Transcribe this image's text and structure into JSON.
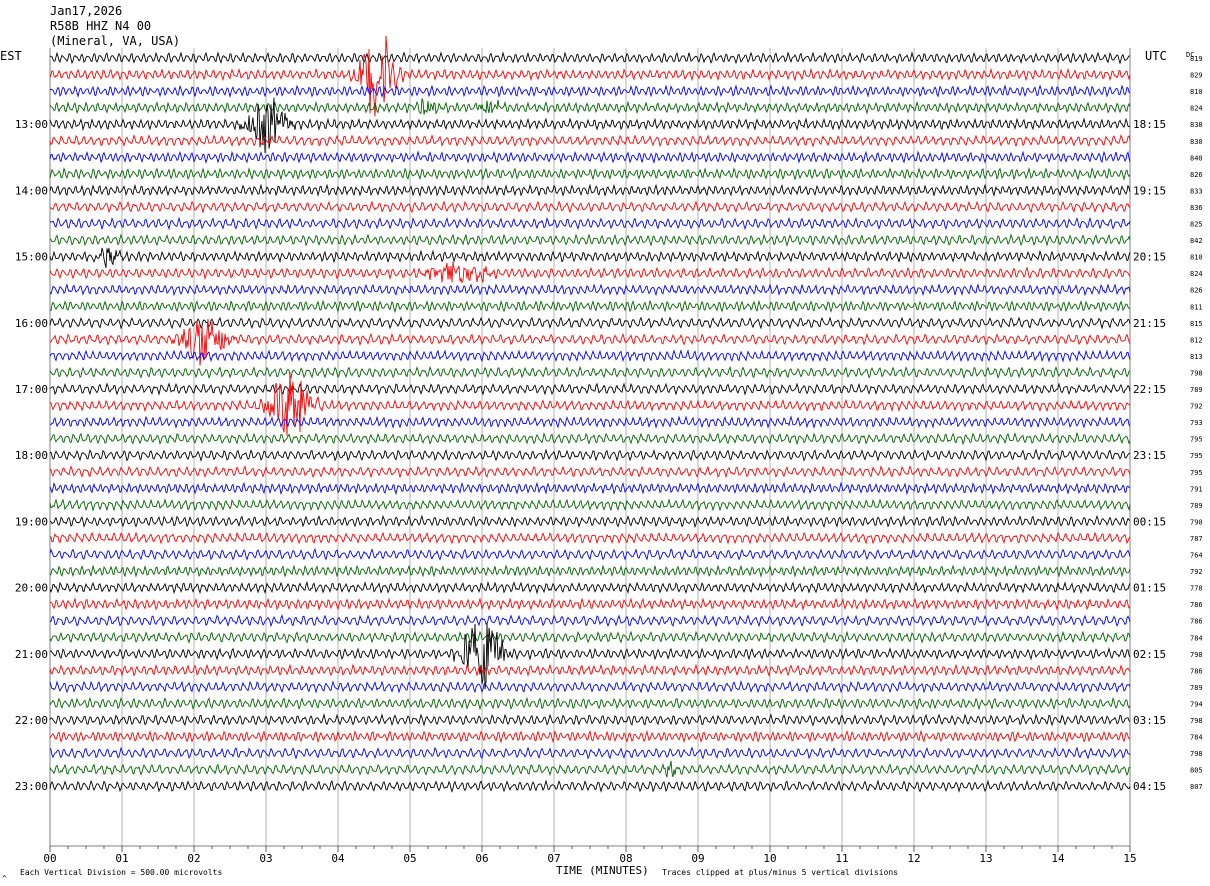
{
  "header": {
    "date": "Jan17,2026",
    "station": "R58B HHZ N4 00",
    "location": "(Mineral, VA, USA)"
  },
  "left_axis_label": "EST",
  "right_axis_label": "UTC",
  "dc_label": "DC",
  "xaxis_title": "TIME (MINUTES)",
  "footer": {
    "scale": "Each Vertical Division =  500.00 microvolts",
    "clip": "Traces clipped at plus/minus 5 vertical divisions",
    "corner_mark": "^"
  },
  "colors": {
    "trace_cycle": [
      "#000000",
      "#ff0000",
      "#0000ff",
      "#006400"
    ],
    "grid": "#808080",
    "text": "#000000",
    "background": "#ffffff"
  },
  "chart_data": {
    "type": "line",
    "title": "",
    "xlabel": "TIME (MINUTES)",
    "ylabel": "",
    "xlim": [
      0,
      15
    ],
    "x_ticks": [
      "00",
      "01",
      "02",
      "03",
      "04",
      "05",
      "06",
      "07",
      "08",
      "09",
      "10",
      "11",
      "12",
      "13",
      "14",
      "15"
    ],
    "grid": true,
    "row_minutes": 15,
    "left_hour_labels": [
      {
        "row": 4,
        "label": "13:00"
      },
      {
        "row": 8,
        "label": "14:00"
      },
      {
        "row": 12,
        "label": "15:00"
      },
      {
        "row": 16,
        "label": "16:00"
      },
      {
        "row": 20,
        "label": "17:00"
      },
      {
        "row": 24,
        "label": "18:00"
      },
      {
        "row": 28,
        "label": "19:00"
      },
      {
        "row": 32,
        "label": "20:00"
      },
      {
        "row": 36,
        "label": "21:00"
      },
      {
        "row": 40,
        "label": "22:00"
      },
      {
        "row": 44,
        "label": "23:00"
      }
    ],
    "right_hour_labels": [
      {
        "row": 4,
        "label": "18:15"
      },
      {
        "row": 8,
        "label": "19:15"
      },
      {
        "row": 12,
        "label": "20:15"
      },
      {
        "row": 16,
        "label": "21:15"
      },
      {
        "row": 20,
        "label": "22:15"
      },
      {
        "row": 24,
        "label": "23:15"
      },
      {
        "row": 28,
        "label": "00:15"
      },
      {
        "row": 32,
        "label": "01:15"
      },
      {
        "row": 36,
        "label": "02:15"
      },
      {
        "row": 40,
        "label": "03:15"
      },
      {
        "row": 44,
        "label": "04:15"
      }
    ],
    "dc_values": [
      "819",
      "829",
      "810",
      "824",
      "838",
      "830",
      "840",
      "826",
      "833",
      "836",
      "825",
      "842",
      "810",
      "824",
      "826",
      "811",
      "815",
      "812",
      "813",
      "798",
      "789",
      "792",
      "793",
      "795",
      "795",
      "795",
      "791",
      "789",
      "790",
      "787",
      "764",
      "792",
      "778",
      "786",
      "786",
      "784",
      "798",
      "786",
      "789",
      "794",
      "798",
      "784",
      "798",
      "805",
      "807"
    ],
    "events": [
      {
        "row": 1,
        "minute": 4.55,
        "amplitude_divisions": 5,
        "duration_min": 0.5,
        "color": "#ff0000"
      },
      {
        "row": 3,
        "minute": 5.2,
        "amplitude_divisions": 0.9,
        "duration_min": 0.4,
        "color": "#006400"
      },
      {
        "row": 3,
        "minute": 6.1,
        "amplitude_divisions": 1.0,
        "duration_min": 0.3,
        "color": "#006400"
      },
      {
        "row": 4,
        "minute": 3.0,
        "amplitude_divisions": 3,
        "duration_min": 0.6,
        "color": "#000000"
      },
      {
        "row": 12,
        "minute": 0.8,
        "amplitude_divisions": 1.0,
        "duration_min": 0.4,
        "color": "#000000"
      },
      {
        "row": 13,
        "minute": 5.7,
        "amplitude_divisions": 1.2,
        "duration_min": 0.9,
        "color": "#ff0000"
      },
      {
        "row": 17,
        "minute": 2.15,
        "amplitude_divisions": 3,
        "duration_min": 0.6,
        "color": "#ff0000"
      },
      {
        "row": 21,
        "minute": 3.35,
        "amplitude_divisions": 4,
        "duration_min": 0.6,
        "color": "#ff0000"
      },
      {
        "row": 36,
        "minute": 6.0,
        "amplitude_divisions": 4,
        "duration_min": 0.6,
        "color": "#000000"
      },
      {
        "row": 43,
        "minute": 8.6,
        "amplitude_divisions": 0.9,
        "duration_min": 0.2,
        "color": "#006400"
      }
    ]
  }
}
